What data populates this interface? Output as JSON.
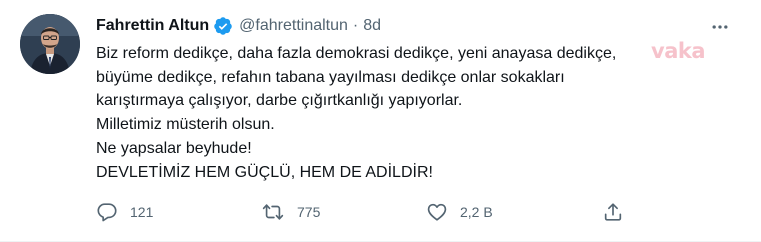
{
  "tweet": {
    "author_name": "Fahrettin Altun",
    "handle": "@fahrettinaltun",
    "separator": "·",
    "time": "8d",
    "text_lines": [
      "Biz reform dedikçe, daha fazla demokrasi dedikçe, yeni anayasa dedikçe,",
      "büyüme dedikçe, refahın tabana yayılması dedikçe onlar sokakları",
      "karıştırmaya çalışıyor, darbe çığırtkanlığı yapıyorlar.",
      "Milletimiz müsterih olsun.",
      "Ne yapsalar beyhude!",
      "DEVLETİMİZ HEM GÜÇLÜ, HEM DE ADİLDİR!"
    ],
    "watermark": "vaka",
    "actions": {
      "reply_count": "121",
      "retweet_count": "775",
      "like_count": "2,2 B"
    },
    "icons": {
      "verified": "verified-badge-icon",
      "more": "more-options-icon",
      "reply": "reply-icon",
      "retweet": "retweet-icon",
      "like": "heart-icon",
      "share": "share-icon"
    },
    "colors": {
      "verified_blue": "#1d9bf0",
      "text": "#0f1419",
      "secondary_text": "#536471",
      "watermark": "#ec788c"
    }
  }
}
